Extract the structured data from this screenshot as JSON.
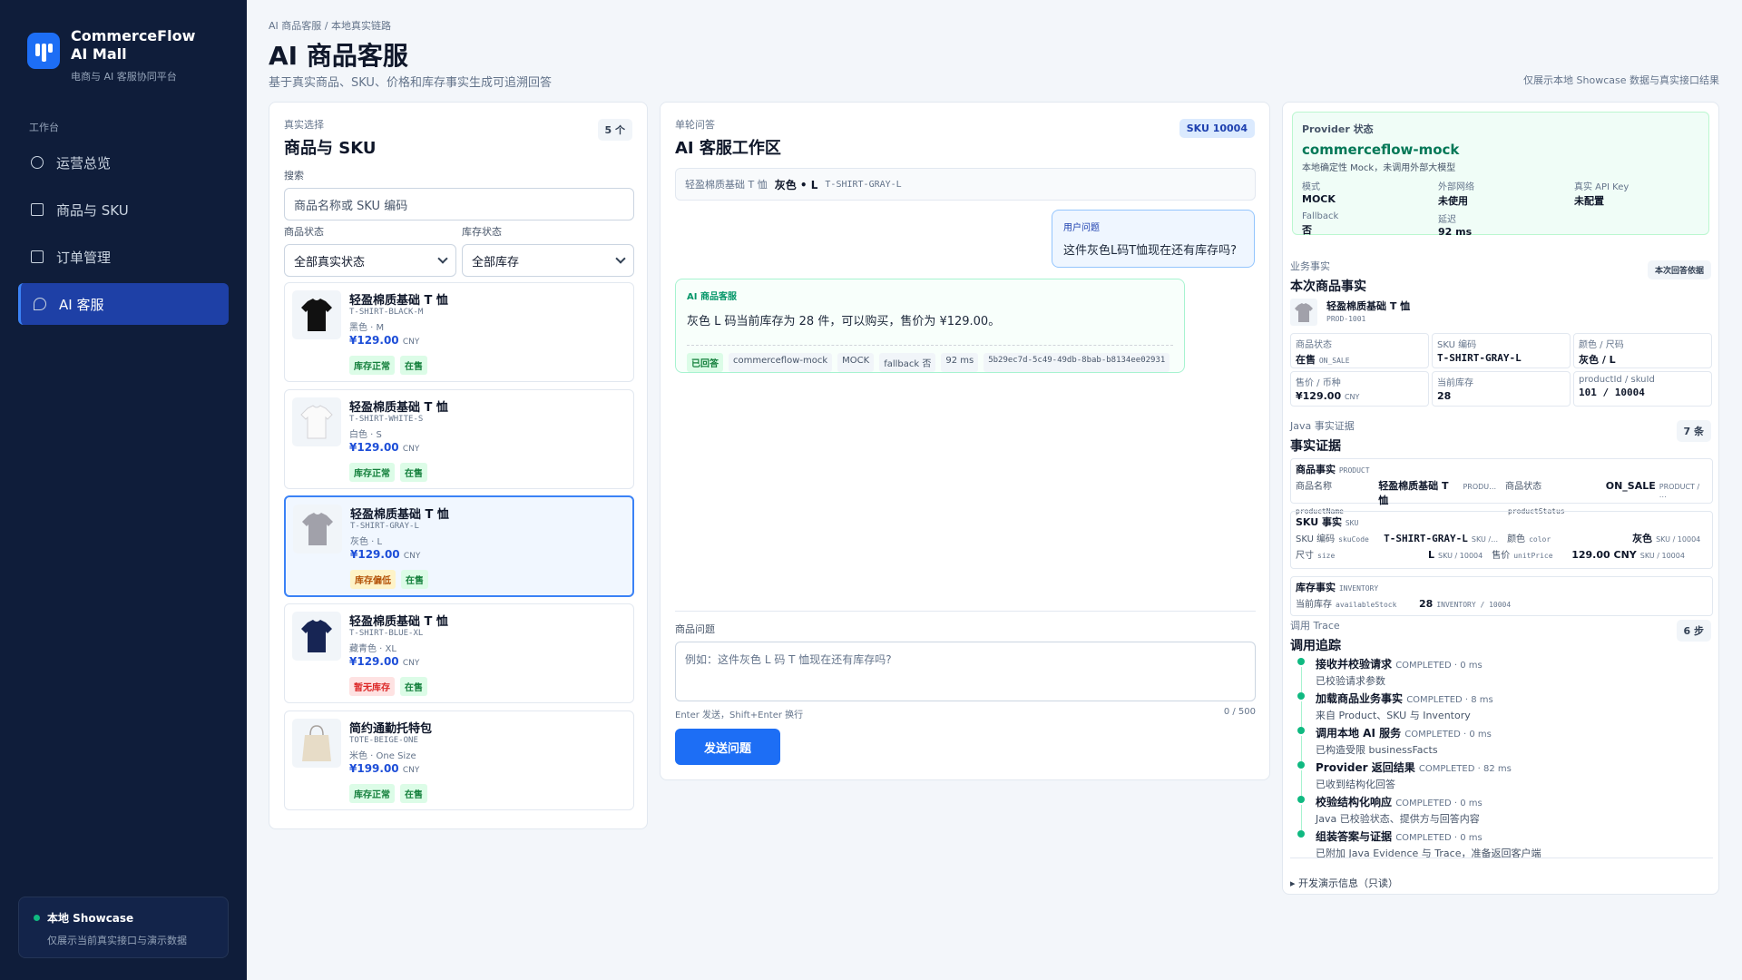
{
  "sidebar": {
    "brand_title": "CommerceFlow AI Mall",
    "brand_subtitle": "电商与 AI 客服协同平台",
    "section": "工作台",
    "items": [
      {
        "label": "运营总览",
        "icon": "circle-icon"
      },
      {
        "label": "商品与 SKU",
        "icon": "box-icon"
      },
      {
        "label": "订单管理",
        "icon": "order-icon"
      },
      {
        "label": "AI 客服",
        "icon": "chat-icon"
      }
    ],
    "showcase_title": "本地 Showcase",
    "showcase_desc": "仅展示当前真实接口与演示数据"
  },
  "header": {
    "breadcrumb": "AI 商品客服 / 本地真实链路",
    "title": "AI 商品客服",
    "subtitle": "基于真实商品、SKU、价格和库存事实生成可追溯回答",
    "note": "仅展示本地 Showcase 数据与真实接口结果"
  },
  "left": {
    "eyebrow": "真实选择",
    "title": "商品与 SKU",
    "count": "5 个",
    "search_label": "搜索",
    "search_placeholder": "商品名称或 SKU 编码",
    "status_label": "商品状态",
    "status_value": "全部真实状态",
    "stock_label": "库存状态",
    "stock_value": "全部库存",
    "products": [
      {
        "name": "轻盈棉质基础 T 恤",
        "sku": "T-SHIRT-BLACK-M",
        "variant": "黑色 · M",
        "price": "¥129.00",
        "currency": "CNY",
        "stock": "库存正常",
        "status": "在售"
      },
      {
        "name": "轻盈棉质基础 T 恤",
        "sku": "T-SHIRT-WHITE-S",
        "variant": "白色 · S",
        "price": "¥129.00",
        "currency": "CNY",
        "stock": "库存正常",
        "status": "在售"
      },
      {
        "name": "轻盈棉质基础 T 恤",
        "sku": "T-SHIRT-GRAY-L",
        "variant": "灰色 · L",
        "price": "¥129.00",
        "currency": "CNY",
        "stock": "库存偏低",
        "status": "在售"
      },
      {
        "name": "轻盈棉质基础 T 恤",
        "sku": "T-SHIRT-BLUE-XL",
        "variant": "藏青色 · XL",
        "price": "¥129.00",
        "currency": "CNY",
        "stock": "暂无库存",
        "status": "在售"
      },
      {
        "name": "简约通勤托特包",
        "sku": "TOTE-BEIGE-ONE",
        "variant": "米色 · One Size",
        "price": "¥199.00",
        "currency": "CNY",
        "stock": "库存正常",
        "status": "在售"
      }
    ]
  },
  "mid": {
    "eyebrow": "单轮问答",
    "title": "AI 客服工作区",
    "sku_badge": "SKU 10004",
    "ctx_name": "轻盈棉质基础 T 恤",
    "ctx_variant": "灰色 • L",
    "ctx_sku": "T-SHIRT-GRAY-L",
    "user_label": "用户问题",
    "user_question": "这件灰色L码T恤现在还有库存吗?",
    "ai_label": "AI 商品客服",
    "ai_answer": "灰色 L 码当前库存为 28 件，可以购买，售价为 ¥129.00。",
    "meta": [
      "已回答",
      "commerceflow-mock",
      "MOCK",
      "fallback 否",
      "92 ms",
      "5b29ec7d-5c49-49db-8bab-b8134ee02931"
    ],
    "q_label": "商品问题",
    "q_placeholder": "例如：这件灰色 L 码 T 恤现在还有库存吗?",
    "hint": "Enter 发送，Shift+Enter 换行",
    "counter": "0 / 500",
    "send": "发送问题"
  },
  "right": {
    "prov_label": "Provider 状态",
    "prov_name": "commerceflow-mock",
    "prov_desc": "本地确定性 Mock，未调用外部大模型",
    "prov": [
      {
        "k": "模式",
        "v": "MOCK"
      },
      {
        "k": "外部网络",
        "v": "未使用"
      },
      {
        "k": "真实 API Key",
        "v": "未配置"
      },
      {
        "k": "Fallback",
        "v": "否"
      },
      {
        "k": "延迟",
        "v": "92 ms"
      }
    ],
    "biz_eyebrow": "业务事实",
    "biz_title": "本次商品事实",
    "biz_badge": "本次回答依据",
    "biz_name": "轻盈棉质基础 T 恤",
    "biz_code": "PROD-1001",
    "facts": [
      {
        "k": "商品状态",
        "v": "在售",
        "s": "ON_SALE"
      },
      {
        "k": "SKU 编码",
        "v": "T-SHIRT-GRAY-L",
        "s": ""
      },
      {
        "k": "颜色 / 尺码",
        "v": "灰色 / L",
        "s": ""
      },
      {
        "k": "售价 / 币种",
        "v": "¥129.00",
        "s": "CNY"
      },
      {
        "k": "当前库存",
        "v": "28",
        "s": ""
      },
      {
        "k": "productId / skuId",
        "v": "101 / 10004",
        "s": ""
      }
    ],
    "ev_eyebrow": "Java 事实证据",
    "ev_title": "事实证据",
    "ev_badge": "7 条",
    "ev": {
      "p_title": "商品事实",
      "p_tag": "PRODUCT",
      "p_k1": "商品名称",
      "p_f1": "productName",
      "p_v1": "轻盈棉质基础 T 恤",
      "p_s1": "PRODU…",
      "p_k2": "商品状态",
      "p_f2": "productStatus",
      "p_v2": "ON_SALE",
      "p_s2": "PRODUCT / …",
      "s_title": "SKU 事实",
      "s_tag": "SKU",
      "s_k1": "SKU 编码",
      "s_f1": "skuCode",
      "s_v1": "T-SHIRT-GRAY-L",
      "s_s1": "SKU /…",
      "s_k2": "颜色",
      "s_f2": "color",
      "s_v2": "灰色",
      "s_s2": "SKU / 10004",
      "s_k3": "尺寸",
      "s_f3": "size",
      "s_v3": "L",
      "s_s3": "SKU / 10004",
      "s_k4": "售价",
      "s_f4": "unitPrice",
      "s_v4": "129.00 CNY",
      "s_s4": "SKU / 10004",
      "i_title": "库存事实",
      "i_tag": "INVENTORY",
      "i_k1": "当前库存",
      "i_f1": "availableStock",
      "i_v1": "28",
      "i_s1": "INVENTORY / 10004"
    },
    "trace_eyebrow": "调用 Trace",
    "trace_title": "调用追踪",
    "trace_badge": "6 步",
    "trace": [
      {
        "n": "接收并校验请求",
        "s": "COMPLETED · 0 ms",
        "d": "已校验请求参数"
      },
      {
        "n": "加载商品业务事实",
        "s": "COMPLETED · 8 ms",
        "d": "来自 Product、SKU 与 Inventory"
      },
      {
        "n": "调用本地 AI 服务",
        "s": "COMPLETED · 0 ms",
        "d": "已构造受限 businessFacts"
      },
      {
        "n": "Provider 返回结果",
        "s": "COMPLETED · 82 ms",
        "d": "已收到结构化回答"
      },
      {
        "n": "校验结构化响应",
        "s": "COMPLETED · 0 ms",
        "d": "Java 已校验状态、提供方与回答内容"
      },
      {
        "n": "组装答案与证据",
        "s": "COMPLETED · 0 ms",
        "d": "已附加 Java Evidence 与 Trace，准备返回客户端"
      }
    ],
    "dev": "▸ 开发演示信息（只读）"
  }
}
